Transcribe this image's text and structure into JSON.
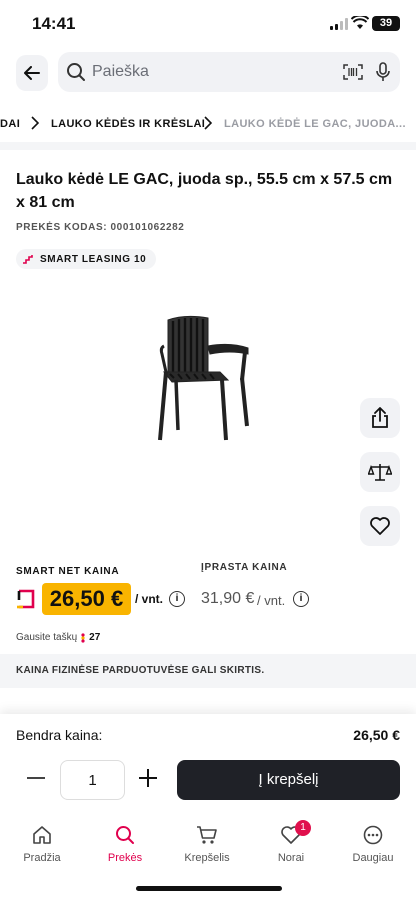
{
  "status_bar": {
    "time": "14:41",
    "battery": "39"
  },
  "search": {
    "placeholder": "Paieška"
  },
  "breadcrumb": [
    "DAI",
    "LAUKO KĖDĖS IR KRĖSLAI",
    "LAUKO KĖDĖ LE GAC, JUODA..."
  ],
  "product": {
    "title": "Lauko kėdė LE GAC, juoda sp., 55.5 cm x 57.5 cm x 81 cm",
    "code": "PREKĖS KODAS: 000101062282",
    "leasing_label": "SMART LEASING 10"
  },
  "pricing": {
    "smart_label": "SMART NET KAINA",
    "smart_price": "26,50 €",
    "smart_unit": "/ vnt.",
    "regular_label": "ĮPRASTA KAINA",
    "regular_price": "31,90 €",
    "regular_unit": "/ vnt.",
    "points_label": "Gausite taškų",
    "points_value": "27",
    "info_glyph": "i"
  },
  "notice": "KAINA FIZINĖSE PARDUOTUVĖSE GALI SKIRTIS.",
  "cart": {
    "total_label": "Bendra kaina:",
    "total_value": "26,50 €",
    "quantity": "1",
    "add_button": "Į krepšelį"
  },
  "tabs": [
    {
      "label": "Pradžia",
      "icon": "home-icon"
    },
    {
      "label": "Prekės",
      "icon": "search-icon",
      "active": true
    },
    {
      "label": "Krepšelis",
      "icon": "cart-icon"
    },
    {
      "label": "Norai",
      "icon": "heart-icon",
      "badge": "1"
    },
    {
      "label": "Daugiau",
      "icon": "more-icon"
    }
  ],
  "colors": {
    "price_highlight": "#f9b400",
    "accent": "#e0004d",
    "button_dark": "#1f2127"
  }
}
